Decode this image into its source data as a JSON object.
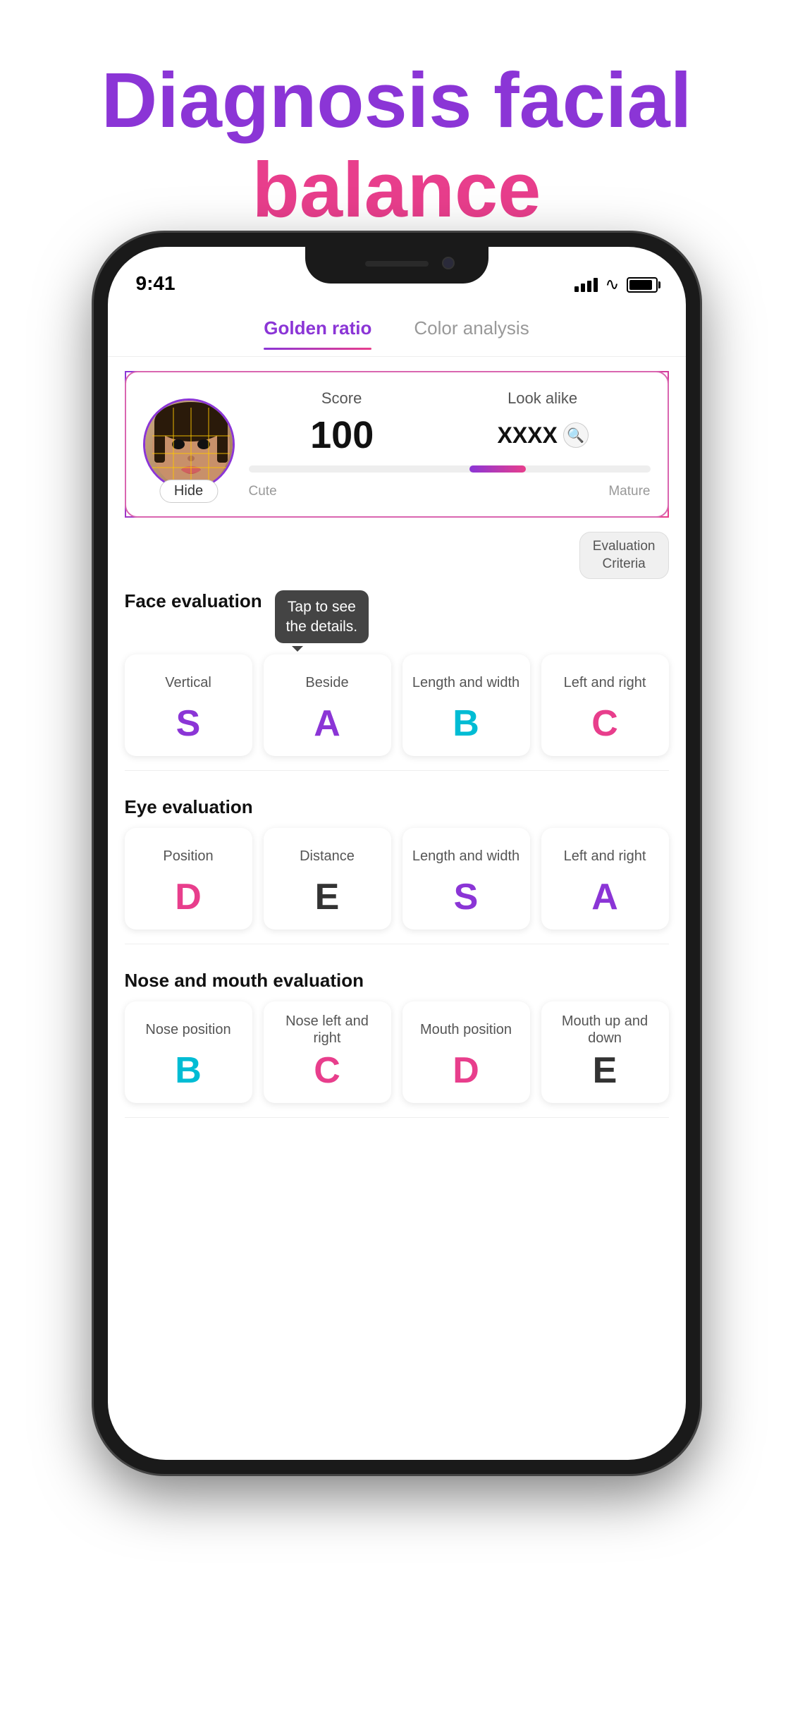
{
  "header": {
    "title_part1": "Diagnosis facial",
    "title_part2": "balance"
  },
  "status_bar": {
    "time": "9:41",
    "signal": "●●●●",
    "wifi": "WiFi",
    "battery": "100%"
  },
  "tabs": [
    {
      "id": "golden-ratio",
      "label": "Golden ratio",
      "active": true
    },
    {
      "id": "color-analysis",
      "label": "Color analysis",
      "active": false
    }
  ],
  "score_card": {
    "score_label": "Score",
    "lookalike_label": "Look alike",
    "score_value": "100",
    "lookalike_value": "XXXX",
    "hide_button": "Hide",
    "progress_left_label": "Cute",
    "progress_right_label": "Mature"
  },
  "evaluation_criteria_btn": {
    "line1": "Evaluation",
    "line2": "Criteria"
  },
  "tooltip": {
    "text": "Tap to see\nthe details."
  },
  "face_evaluation": {
    "title": "Face evaluation",
    "cards": [
      {
        "label": "Vertical",
        "grade": "S",
        "color_class": "grade-s"
      },
      {
        "label": "Beside",
        "grade": "A",
        "color_class": "grade-a"
      },
      {
        "label": "Length and width",
        "grade": "B",
        "color_class": "grade-b"
      },
      {
        "label": "Left and right",
        "grade": "C",
        "color_class": "grade-c"
      }
    ]
  },
  "eye_evaluation": {
    "title": "Eye evaluation",
    "cards": [
      {
        "label": "Position",
        "grade": "D",
        "color_class": "grade-d"
      },
      {
        "label": "Distance",
        "grade": "E",
        "color_class": "grade-e"
      },
      {
        "label": "Length and width",
        "grade": "S",
        "color_class": "grade-s"
      },
      {
        "label": "Left and right",
        "grade": "A",
        "color_class": "grade-a"
      }
    ]
  },
  "nose_mouth_evaluation": {
    "title": "Nose and mouth evaluation",
    "cards": [
      {
        "label": "Nose position",
        "grade": "B",
        "color_class": "grade-b"
      },
      {
        "label": "Nose left and right",
        "grade": "C",
        "color_class": "grade-c"
      },
      {
        "label": "Mouth position",
        "grade": "D",
        "color_class": "grade-d"
      },
      {
        "label": "Mouth up and down",
        "grade": "E",
        "color_class": "grade-e"
      }
    ]
  }
}
